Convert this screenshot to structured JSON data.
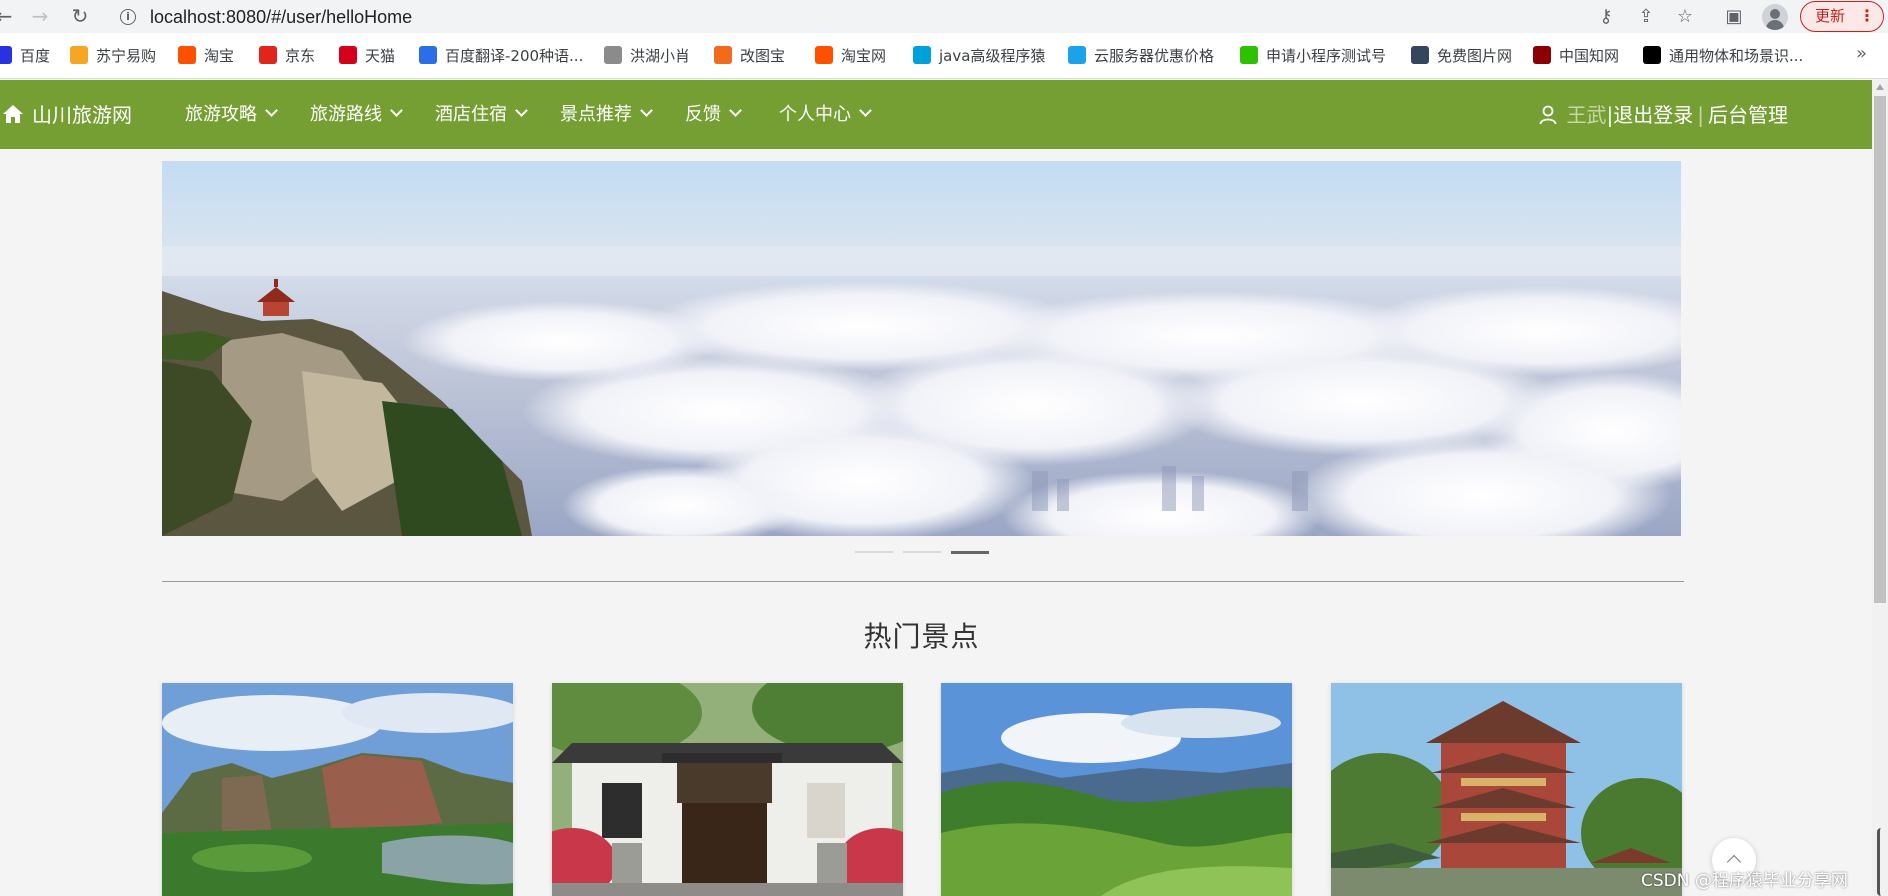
{
  "browser": {
    "url": "localhost:8080/#/user/helloHome",
    "update_label": "更新",
    "bookmarks": [
      {
        "label": "百度",
        "icon": "baidu-icon",
        "color": "#2932e1"
      },
      {
        "label": "苏宁易购",
        "icon": "suning-icon",
        "color": "#f5a623"
      },
      {
        "label": "淘宝",
        "icon": "taobao-icon",
        "color": "#ff5000"
      },
      {
        "label": "京东",
        "icon": "jd-icon",
        "color": "#e1251b"
      },
      {
        "label": "天猫",
        "icon": "tmall-icon",
        "color": "#d5001c"
      },
      {
        "label": "百度翻译-200种语...",
        "icon": "translate-icon",
        "color": "#2b6ee8"
      },
      {
        "label": "洪湖小肖",
        "icon": "bird-icon",
        "color": "#8b8b8b"
      },
      {
        "label": "改图宝",
        "icon": "gaitubao-icon",
        "color": "#f26b1d"
      },
      {
        "label": "淘宝网",
        "icon": "taobao-net-icon",
        "color": "#ff5000"
      },
      {
        "label": "java高级程序猿",
        "icon": "bilibili-icon",
        "color": "#00a1d6"
      },
      {
        "label": "云服务器优惠价格",
        "icon": "cloud-icon",
        "color": "#1aa3e8"
      },
      {
        "label": "申请小程序测试号",
        "icon": "wechat-icon",
        "color": "#2dc100"
      },
      {
        "label": "免费图片网",
        "icon": "tumblr-icon",
        "color": "#35465c"
      },
      {
        "label": "中国知网",
        "icon": "cnki-icon",
        "color": "#8b0000"
      },
      {
        "label": "通用物体和场景识...",
        "icon": "ai-icon",
        "color": "#000000"
      }
    ]
  },
  "header": {
    "logo": "山川旅游网",
    "nav": [
      {
        "label": "旅游攻略"
      },
      {
        "label": "旅游路线"
      },
      {
        "label": "酒店住宿"
      },
      {
        "label": "景点推荐"
      },
      {
        "label": "反馈"
      },
      {
        "label": "个人中心"
      }
    ],
    "user_name": "王武",
    "logout_label": "|退出登录",
    "admin_label": "后台管理",
    "separator": "|",
    "accent_color": "#759e33"
  },
  "carousel": {
    "slide_count": 3,
    "active_index": 2
  },
  "section": {
    "title": "热门景点"
  },
  "watermark": "CSDN @程序猿毕业分享网"
}
